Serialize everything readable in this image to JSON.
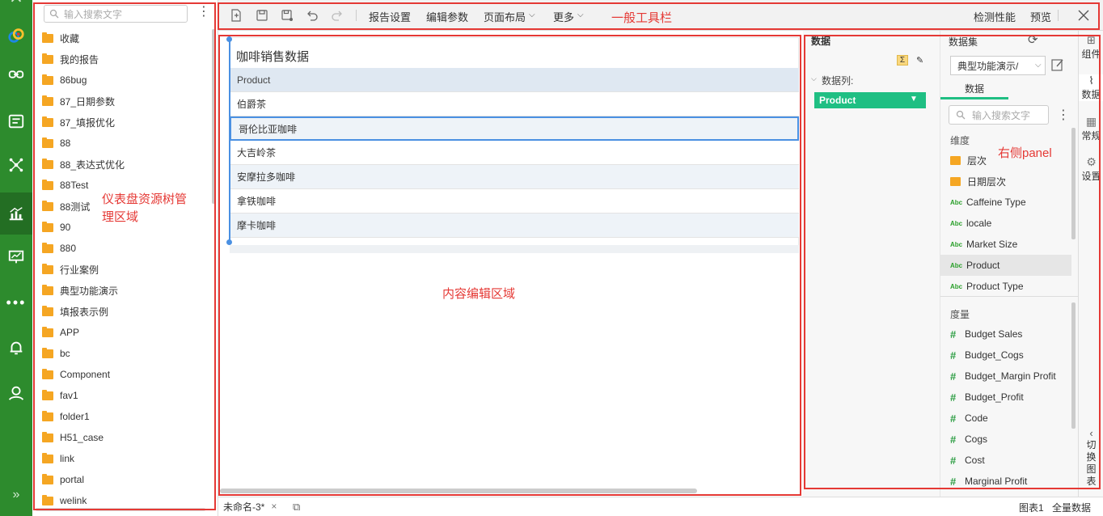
{
  "tree": {
    "search_placeholder": "输入搜索文字",
    "items": [
      "收藏",
      "我的报告",
      "86bug",
      "87_日期参数",
      "87_填报优化",
      "88",
      "88_表达式优化",
      "88Test",
      "88测试",
      "90",
      "880",
      "行业案例",
      "典型功能演示",
      "填报表示例",
      "APP",
      "bc",
      "Component",
      "fav1",
      "folder1",
      "H51_case",
      "link",
      "portal",
      "welink"
    ]
  },
  "toolbar": {
    "report_settings": "报告设置",
    "edit_params": "编辑参数",
    "page_layout": "页面布局",
    "more": "更多",
    "check_perf": "检测性能",
    "preview": "预览"
  },
  "table": {
    "title": "咖啡销售数据",
    "header": "Product",
    "rows": [
      "伯爵茶",
      "哥伦比亚咖啡",
      "大吉岭茶",
      "安摩拉多咖啡",
      "拿铁咖啡",
      "摩卡咖啡"
    ]
  },
  "data_panel": {
    "title": "数据",
    "columns_label": "数据列:",
    "column_chip": "Product"
  },
  "field_panel": {
    "dataset_label": "数据集",
    "dataset_value": "典型功能演示/",
    "tab_data": "数据",
    "search_placeholder": "输入搜索文字",
    "dimension_label": "维度",
    "dimensions": [
      {
        "name": "层次",
        "kind": "folder"
      },
      {
        "name": "日期层次",
        "kind": "folder"
      },
      {
        "name": "Caffeine Type",
        "kind": "abc"
      },
      {
        "name": "locale",
        "kind": "abc"
      },
      {
        "name": "Market Size",
        "kind": "abc"
      },
      {
        "name": "Product",
        "kind": "abc"
      },
      {
        "name": "Product Type",
        "kind": "abc"
      }
    ],
    "measure_label": "度量",
    "measures": [
      "Budget Sales",
      "Budget_Cogs",
      "Budget_Margin Profit",
      "Budget_Profit",
      "Code",
      "Cogs",
      "Cost",
      "Marginal Profit"
    ],
    "abc_glyph": "Abc",
    "hash_glyph": "#"
  },
  "side_tabs": {
    "component": "组件",
    "data": "数据",
    "general": "常规",
    "settings": "设置",
    "switch_chart": "切换图表"
  },
  "status": {
    "tab_name": "未命名-3*",
    "chart_label": "图表1",
    "full_data": "全量数据"
  },
  "annotations": {
    "toolbar": "一般工具栏",
    "tree": "仪表盘资源树管理区域",
    "content": "内容编辑区域",
    "right_panel": "右侧panel"
  },
  "colors": {
    "sidebar": "#2d8b2d",
    "annotation": "#e53935",
    "chip": "#1fbf83",
    "folder": "#f5a623"
  }
}
